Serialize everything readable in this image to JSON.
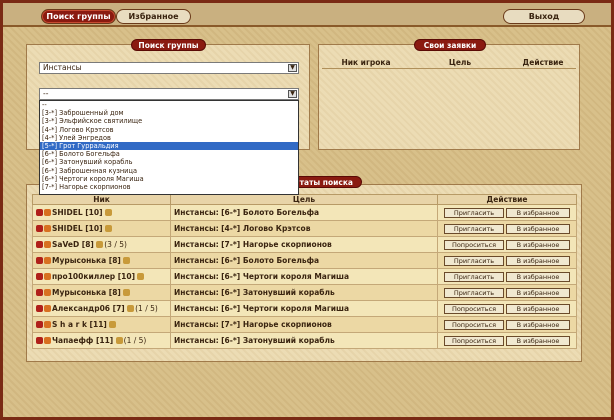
{
  "topbar": {
    "tab_search": "Поиск группы",
    "tab_favorites": "Избранное",
    "exit": "Выход"
  },
  "search_panel": {
    "title": "Поиск группы",
    "category_select": "Инстансы",
    "location_select": "--",
    "options": [
      {
        "label": "--",
        "highlighted": false
      },
      {
        "label": "[3-*] Заброшенный дом",
        "highlighted": false
      },
      {
        "label": "[3-*] Эльфийское святилище",
        "highlighted": false
      },
      {
        "label": "[4-*] Логово Крэтсов",
        "highlighted": false
      },
      {
        "label": "[4-*] Улей Энгредов",
        "highlighted": false
      },
      {
        "label": "[5-*] Грот Гурральдия",
        "highlighted": true
      },
      {
        "label": "[6-*] Болото Богельфа",
        "highlighted": false
      },
      {
        "label": "[6-*] Затонувший корабль",
        "highlighted": false
      },
      {
        "label": "[6-*] Заброшенная кузница",
        "highlighted": false
      },
      {
        "label": "[6-*] Чертоги короля Магиша",
        "highlighted": false
      },
      {
        "label": "[7-*] Нагорье скорпионов",
        "highlighted": false
      }
    ]
  },
  "requests_panel": {
    "title": "Свои заявки",
    "columns": [
      "Ник игрока",
      "Цель",
      "Действие"
    ]
  },
  "results": {
    "title": "Результаты поиска",
    "title_visible": "...таты поиска",
    "columns": [
      "Ник",
      "Цель",
      "Действие"
    ],
    "rows": [
      {
        "nick": "SHIDEL [10]",
        "extra": "",
        "goal_type": "Инстансы:",
        "goal": "[6-*] Болото Богельфа",
        "btn1": "Пригласить",
        "btn2": "В избранное"
      },
      {
        "nick": "SHIDEL [10]",
        "extra": "",
        "goal_type": "Инстансы:",
        "goal": "[4-*] Логово Крэтсов",
        "btn1": "Пригласить",
        "btn2": "В избранное"
      },
      {
        "nick": "SaVeD [8]",
        "extra": "(3 / 5)",
        "goal_type": "Инстансы:",
        "goal": "[7-*] Нагорье скорпионов",
        "btn1": "Попроситься",
        "btn2": "В избранное"
      },
      {
        "nick": "Мурысонька [8]",
        "extra": "",
        "goal_type": "Инстансы:",
        "goal": "[6-*] Болото Богельфа",
        "btn1": "Пригласить",
        "btn2": "В избранное"
      },
      {
        "nick": "про100киллер [10]",
        "extra": "",
        "goal_type": "Инстансы:",
        "goal": "[6-*] Чертоги короля Магиша",
        "btn1": "Пригласить",
        "btn2": "В избранное"
      },
      {
        "nick": "Мурысонька [8]",
        "extra": "",
        "goal_type": "Инстансы:",
        "goal": "[6-*] Затонувший корабль",
        "btn1": "Пригласить",
        "btn2": "В избранное"
      },
      {
        "nick": "Александр06 [7]",
        "extra": "(1 / 5)",
        "goal_type": "Инстансы:",
        "goal": "[6-*] Чертоги короля Магиша",
        "btn1": "Попроситься",
        "btn2": "В избранное"
      },
      {
        "nick": "S h a r k [11]",
        "extra": "",
        "goal_type": "Инстансы:",
        "goal": "[7-*] Нагорье скорпионов",
        "btn1": "Попроситься",
        "btn2": "В избранное"
      },
      {
        "nick": "Чапаефф [11]",
        "extra": "(1 / 5)",
        "goal_type": "Инстансы:",
        "goal": "[6-*] Затонувший корабль",
        "btn1": "Попроситься",
        "btn2": "В избранное"
      }
    ]
  }
}
